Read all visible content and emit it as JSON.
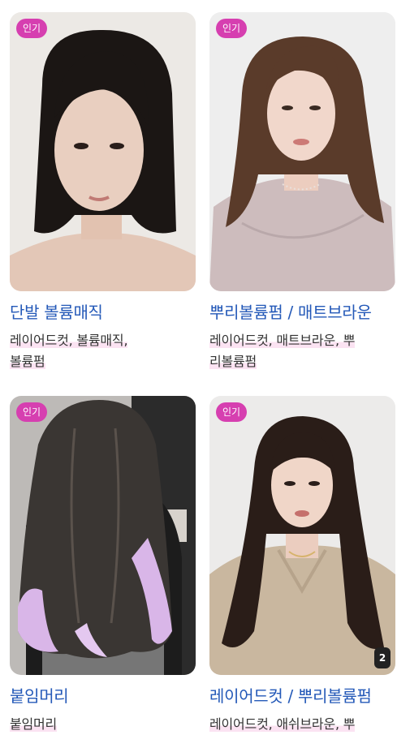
{
  "cards": [
    {
      "badge": "인기",
      "title": "단발 볼륨매직",
      "tags_line1": "레이어드컷, 볼륨매직,",
      "tags_line2": "볼륨펌",
      "hair_color": "#1b1614",
      "bg_color": "#ece9e5",
      "skin_color": "#e9cfc0",
      "cloth_color": "#d9c8bd"
    },
    {
      "badge": "인기",
      "title": "뿌리볼륨펌 / 매트브라운",
      "tags_line1": "레이어드컷, 매트브라운, 뿌",
      "tags_line2": "리볼륨펌",
      "hair_color": "#5a3b2a",
      "bg_color": "#eeeeee",
      "skin_color": "#f1d7cb",
      "cloth_color": "#cdbcbd"
    },
    {
      "badge": "인기",
      "title": "붙임머리",
      "tags_line1": "붙임머리",
      "tags_line2": "",
      "hair_color": "#3a3633",
      "bg_color": "#bdbab7",
      "accent_color": "#d9b6e8",
      "cloth_color": "#1c1c1c"
    },
    {
      "badge": "인기",
      "title": "레이어드컷 / 뿌리볼륨펌",
      "tags_line1": "레이어드컷, 애쉬브라운, 뿌",
      "tags_line2": "",
      "count": "2",
      "hair_color": "#2a1d18",
      "bg_color": "#ecebea",
      "skin_color": "#f0d6c8",
      "cloth_color": "#c9b79f"
    }
  ]
}
